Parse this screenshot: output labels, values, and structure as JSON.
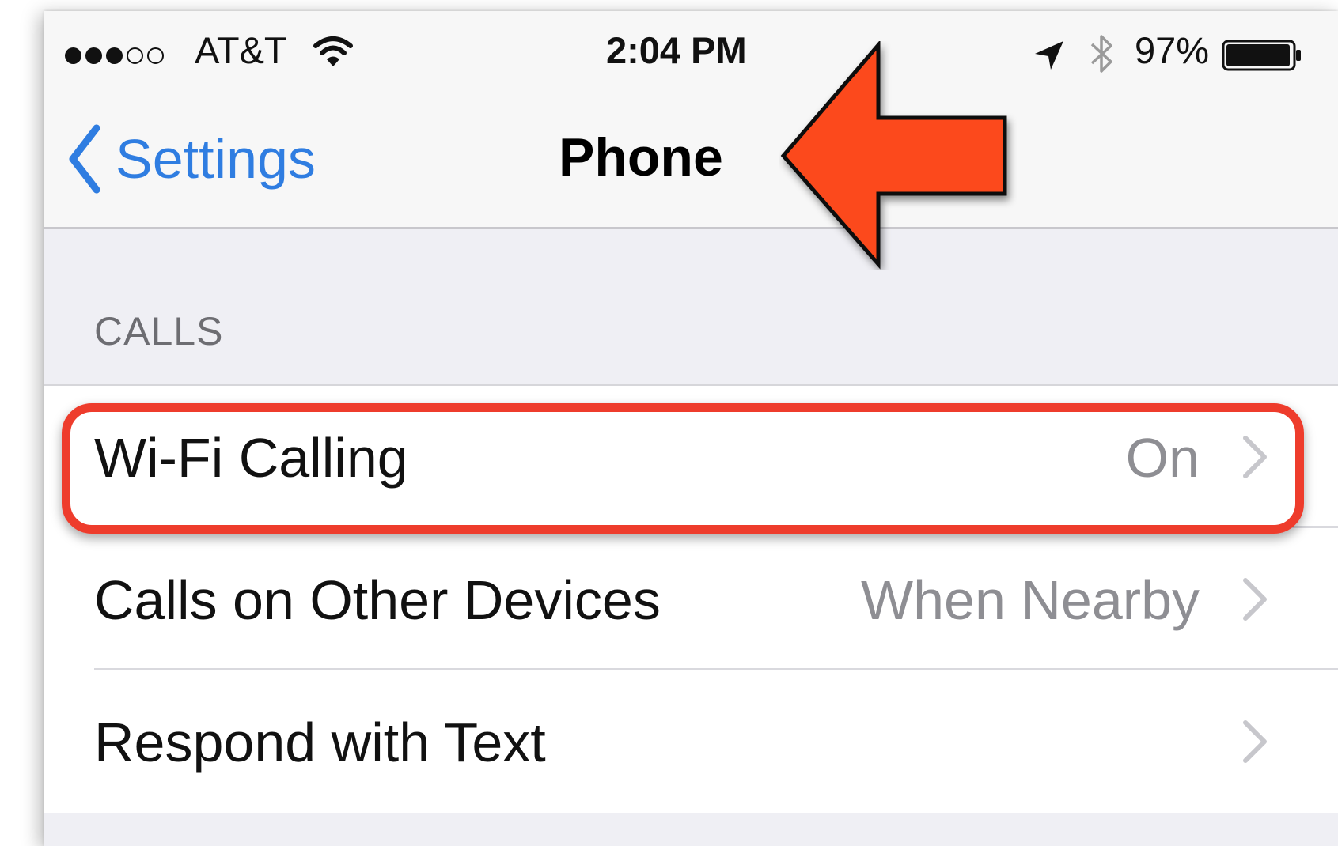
{
  "status_bar": {
    "carrier": "AT&T",
    "time": "2:04 PM",
    "battery_percent": "97%",
    "battery_level": 0.97,
    "signal_bars_filled": 3,
    "signal_bars_total": 5,
    "icons": [
      "wifi-icon",
      "location-arrow-icon",
      "bluetooth-icon",
      "battery-icon"
    ]
  },
  "nav": {
    "back_label": "Settings",
    "title": "Phone"
  },
  "section": {
    "header": "CALLS"
  },
  "rows": [
    {
      "label": "Wi-Fi Calling",
      "value": "On"
    },
    {
      "label": "Calls on Other Devices",
      "value": "When Nearby"
    },
    {
      "label": "Respond with Text",
      "value": ""
    }
  ],
  "annotations": {
    "arrow_color": "#fc4a1a",
    "highlight_color": "#ee3c2c"
  },
  "colors": {
    "accent": "#2f7de1",
    "background": "#efeff4"
  }
}
